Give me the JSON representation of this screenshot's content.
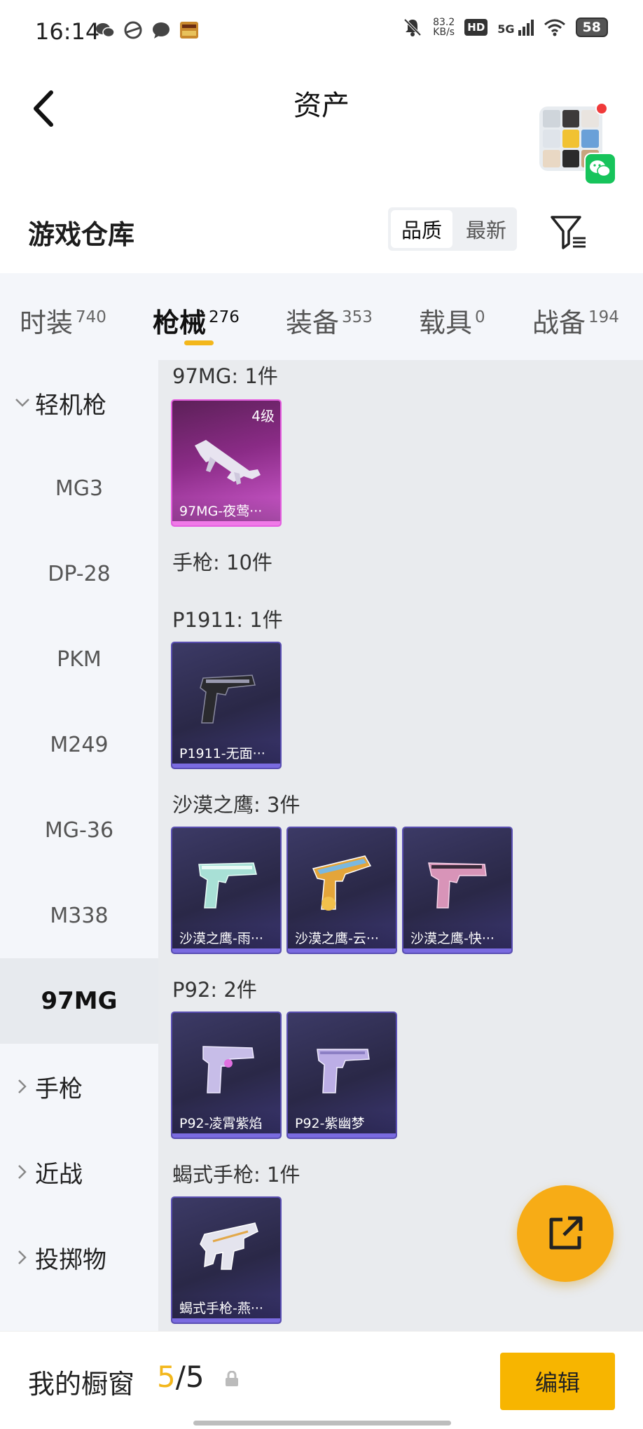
{
  "status_bar": {
    "time": "16:14",
    "net_speed_value": "83.2",
    "net_speed_unit": "KB/s",
    "hd": "HD",
    "signal": "5G",
    "battery": "58"
  },
  "header": {
    "title": "资产"
  },
  "section": {
    "title": "游戏仓库",
    "sort_options": [
      "品质",
      "最新"
    ]
  },
  "tabs": [
    {
      "label": "时装",
      "count": "740"
    },
    {
      "label": "枪械",
      "count": "276"
    },
    {
      "label": "装备",
      "count": "353"
    },
    {
      "label": "载具",
      "count": "0"
    },
    {
      "label": "战备",
      "count": "194"
    }
  ],
  "sidebar": {
    "group_lmg": "轻机枪",
    "items": [
      "MG3",
      "DP-28",
      "PKM",
      "M249",
      "MG-36",
      "M338",
      "97MG"
    ],
    "group_pistol": "手枪",
    "group_melee": "近战",
    "group_throw": "投掷物"
  },
  "content": {
    "g_97mg": "97MG: 1件",
    "card_97mg_level": "4级",
    "card_97mg_name": "97MG-夜莺···",
    "g_pistol": "手枪: 10件",
    "g_p1911": "P1911: 1件",
    "card_p1911_name": "P1911-无面···",
    "g_deagle": "沙漠之鹰: 3件",
    "card_deagle_1": "沙漠之鹰-雨···",
    "card_deagle_2": "沙漠之鹰-云···",
    "card_deagle_3": "沙漠之鹰-快···",
    "g_p92": "P92: 2件",
    "card_p92_1": "P92-凌霄紫焰",
    "card_p92_2": "P92-紫幽梦",
    "g_scorpion": "蝎式手枪: 1件",
    "card_scorpion": "蝎式手枪-燕···"
  },
  "bottom": {
    "window_label": "我的橱窗",
    "window_used": "5",
    "window_total": "/5",
    "edit": "编辑"
  },
  "colors": {
    "accent": "#f7b500",
    "tab_indicator": "#f3b71b",
    "rare_card": "#d35ed3",
    "epic_card": "#5a4fb3",
    "wechat": "#17c45b"
  }
}
